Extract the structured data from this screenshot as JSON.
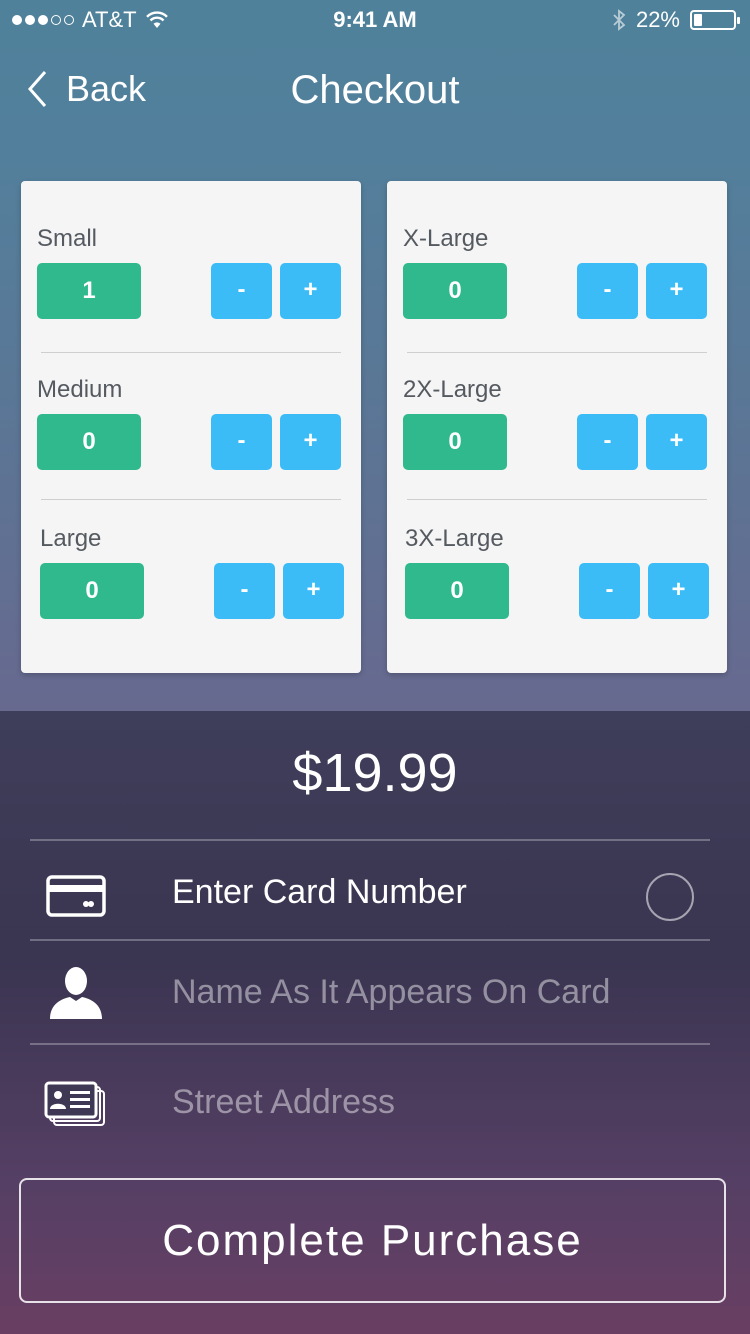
{
  "status_bar": {
    "carrier": "AT&T",
    "time": "9:41 AM",
    "battery_percent": "22%",
    "battery_level": 0.22,
    "signal_bars_filled": 3,
    "signal_bars_total": 5,
    "icons": [
      "wifi-icon",
      "bluetooth-icon",
      "battery-icon"
    ]
  },
  "nav": {
    "back_label": "Back",
    "title": "Checkout"
  },
  "sizes": {
    "left": [
      {
        "label": "Small",
        "qty": "1"
      },
      {
        "label": "Medium",
        "qty": "0"
      },
      {
        "label": "Large",
        "qty": "0"
      }
    ],
    "right": [
      {
        "label": "X-Large",
        "qty": "0"
      },
      {
        "label": "2X-Large",
        "qty": "0"
      },
      {
        "label": "3X-Large",
        "qty": "0"
      }
    ],
    "minus_label": "-",
    "plus_label": "+"
  },
  "price": "$19.99",
  "payment": {
    "card_number": {
      "placeholder": "Enter Card Number",
      "icon": "credit-card-icon"
    },
    "name": {
      "placeholder": "Name As It Appears On Card",
      "icon": "person-icon"
    },
    "address": {
      "placeholder": "Street Address",
      "icon": "address-card-icon"
    }
  },
  "complete_button_label": "Complete Purchase",
  "colors": {
    "qty_green": "#2fb98d",
    "stepper_blue": "#3bbcf7",
    "card_bg": "#f5f5f5"
  }
}
